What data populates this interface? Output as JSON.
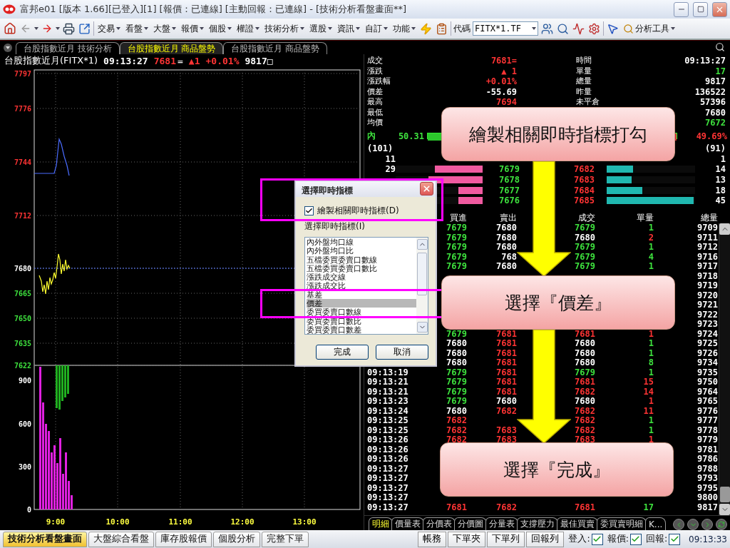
{
  "window": {
    "title": "富邦e01 [版本 1.66][已登入][1] [報價：已連線] [主動回報：已連線] - [技術分析看盤畫面**]"
  },
  "toolbar": {
    "menus": [
      "交易",
      "看盤",
      "大盤",
      "報價",
      "個股",
      "權證",
      "技術分析",
      "選股",
      "資訊",
      "自訂",
      "功能"
    ],
    "code_label": "代碼",
    "code_value": "FITX*1.TF",
    "analysis": "分析工具"
  },
  "tabs": [
    {
      "label": "台股指數近月 技術分析",
      "selected": false
    },
    {
      "label": "台股指數近月 商品盤勢",
      "selected": true
    },
    {
      "label": "台股指數近月 商品盤勢",
      "selected": false
    }
  ],
  "header": {
    "name": "台股指數近月(FITX*1)",
    "time": "09:13:27",
    "price": "7681",
    "flag": "=",
    "change": "▲1",
    "percent": "+0.01%",
    "volume": "9817□"
  },
  "chart": {
    "price_labels": [
      {
        "v": "7797",
        "color": "#ff3434"
      },
      {
        "v": "7776",
        "color": "#ff3434"
      },
      {
        "v": "7744",
        "color": "#ff3434"
      },
      {
        "v": "7712",
        "color": "#ff3434"
      },
      {
        "v": "7680",
        "color": "#ffffff"
      },
      {
        "v": "7665",
        "color": "#3ee23e"
      },
      {
        "v": "7650",
        "color": "#3ee23e"
      },
      {
        "v": "7635",
        "color": "#3ee23e"
      },
      {
        "v": "7622",
        "color": "#3ee23e"
      }
    ],
    "volume_labels": [
      "900",
      "600",
      "300",
      "0"
    ],
    "time_labels": [
      "9:00",
      "10:00",
      "11:00",
      "12:00",
      "13:00"
    ]
  },
  "quote": [
    {
      "left": {
        "label": "成交",
        "value": "7681=",
        "color": "#ff3434"
      },
      "right": {
        "label": "時間",
        "value": "09:13:27",
        "color": "#ffffff"
      }
    },
    {
      "left": {
        "label": "漲跌",
        "value": "▲ 1",
        "color": "#ff3434"
      },
      "right": {
        "label": "單量",
        "value": "17",
        "color": "#3ee23e"
      }
    },
    {
      "left": {
        "label": "漲跌幅",
        "value": "+0.01%",
        "color": "#ff3434"
      },
      "right": {
        "label": "總量",
        "value": "9817",
        "color": "#ffffff"
      }
    },
    {
      "left": {
        "label": "價差",
        "value": "-55.69",
        "color": "#ffffff"
      },
      "right": {
        "label": "昨量",
        "value": "136522",
        "color": "#ffffff"
      }
    },
    {
      "left": {
        "label": "最高",
        "value": "7694",
        "color": "#ff3434"
      },
      "right": {
        "label": "未平倉",
        "value": "57396",
        "color": "#ffffff"
      }
    },
    {
      "left": {
        "label": "最低"
      },
      "right": {
        "value": "7680",
        "color": "#ffffff"
      }
    },
    {
      "left": {
        "label": "均價"
      },
      "right": {
        "value": "7672",
        "color": "#3ee23e"
      }
    }
  ],
  "ratio": {
    "in_label": "內",
    "in_value": "50.31",
    "level": 0.5031,
    "out_value": "49.69%"
  },
  "counts": {
    "left": "(101)",
    "right": "(91)"
  },
  "book": [
    {
      "bid_vol": "11",
      "ask_vol": "1"
    },
    {
      "bid_vol": "29",
      "bid_bar": {
        "level": 0.55
      },
      "bid": "7679",
      "ask": "7682",
      "ask_bar": {
        "level": 0.3
      },
      "ask_vol": "14"
    },
    {
      "bid_bar": {
        "level": 0.62
      },
      "bid": "7678",
      "ask": "7683",
      "ask_bar": {
        "level": 0.28
      },
      "ask_vol": "13"
    },
    {
      "bid_bar": {
        "level": 0.28
      },
      "bid": "7677",
      "ask": "7684",
      "ask_bar": {
        "level": 0.4
      },
      "ask_vol": "18"
    },
    {
      "bid_bar": {
        "level": 0.28
      },
      "bid": "7676",
      "ask": "7685",
      "ask_bar": {
        "level": 0.98
      },
      "ask_vol": "45"
    }
  ],
  "ticks": {
    "columns": [
      "買進",
      "賣出",
      "成交",
      "單量",
      "總量"
    ],
    "rows": [
      {
        "bid": {
          "v": "7679",
          "color": "#3ee23e"
        },
        "ask": {
          "v": "7680",
          "color": "#ffffff"
        },
        "price": {
          "v": "7679",
          "color": "#3ee23e"
        },
        "qty": {
          "v": "1",
          "color": "#3ee23e"
        },
        "total": "9709"
      },
      {
        "bid": {
          "v": "7679",
          "color": "#3ee23e"
        },
        "ask": {
          "v": "7680",
          "color": "#ffffff"
        },
        "price": {
          "v": "7680",
          "color": "#ffffff"
        },
        "qty": {
          "v": "2",
          "color": "#ff3434"
        },
        "total": "9711"
      },
      {
        "bid": {
          "v": "7679",
          "color": "#3ee23e"
        },
        "ask": {
          "v": "7680",
          "color": "#ffffff"
        },
        "price": {
          "v": "7679",
          "color": "#3ee23e"
        },
        "qty": {
          "v": "1",
          "color": "#3ee23e"
        },
        "total": "9712"
      },
      {
        "bid": {
          "v": "7679",
          "color": "#3ee23e"
        },
        "ask": {
          "v": "768",
          "color": "#ffffff"
        },
        "price": {
          "v": "7679",
          "color": "#3ee23e"
        },
        "qty": {
          "v": "4",
          "color": "#3ee23e"
        },
        "total": "9716"
      },
      {
        "bid": {
          "v": "7679",
          "color": "#3ee23e"
        },
        "ask": {
          "v": "7680",
          "color": "#ffffff"
        },
        "price": {
          "v": "7679",
          "color": "#3ee23e"
        },
        "qty": {
          "v": "1",
          "color": "#3ee23e"
        },
        "total": "9717"
      },
      {
        "total": "9718"
      },
      {
        "total": "9719"
      },
      {
        "total": "9720"
      },
      {
        "total": "9721"
      },
      {
        "total": "9722"
      },
      {
        "total": "9723"
      },
      {
        "bid": {
          "v": "7679",
          "color": "#3ee23e"
        },
        "ask": {
          "v": "7681",
          "color": "#ff3434"
        },
        "price": {
          "v": "7681",
          "color": "#ff3434"
        },
        "qty": {
          "v": "1",
          "color": "#ff3434"
        },
        "total": "9724"
      },
      {
        "bid": {
          "v": "7680",
          "color": "#ffffff"
        },
        "ask": {
          "v": "7681",
          "color": "#ff3434"
        },
        "price": {
          "v": "7680",
          "color": "#ffffff"
        },
        "qty": {
          "v": "1",
          "color": "#3ee23e"
        },
        "total": "9725"
      },
      {
        "bid": {
          "v": "7680",
          "color": "#ffffff"
        },
        "ask": {
          "v": "7681",
          "color": "#ff3434"
        },
        "price": {
          "v": "7680",
          "color": "#ffffff"
        },
        "qty": {
          "v": "1",
          "color": "#3ee23e"
        },
        "total": "9726"
      },
      {
        "bid": {
          "v": "7680",
          "color": "#ffffff"
        },
        "ask": {
          "v": "7681",
          "color": "#ff3434"
        },
        "price": {
          "v": "7680",
          "color": "#ffffff"
        },
        "qty": {
          "v": "8",
          "color": "#3ee23e"
        },
        "total": "9734"
      },
      {
        "time": "09:13:19",
        "bid": {
          "v": "7679",
          "color": "#3ee23e"
        },
        "ask": {
          "v": "7681",
          "color": "#ff3434"
        },
        "price": {
          "v": "7679",
          "color": "#3ee23e"
        },
        "qty": {
          "v": "1",
          "color": "#3ee23e"
        },
        "total": "9735"
      },
      {
        "time": "09:13:21",
        "bid": {
          "v": "7679",
          "color": "#3ee23e"
        },
        "ask": {
          "v": "7681",
          "color": "#ff3434"
        },
        "price": {
          "v": "7681",
          "color": "#ff3434"
        },
        "qty": {
          "v": "15",
          "color": "#ff3434"
        },
        "total": "9750"
      },
      {
        "time": "09:13:21",
        "bid": {
          "v": "7679",
          "color": "#3ee23e"
        },
        "ask": {
          "v": "7681",
          "color": "#ff3434"
        },
        "price": {
          "v": "7682",
          "color": "#ff3434"
        },
        "qty": {
          "v": "14",
          "color": "#ff3434"
        },
        "total": "9764"
      },
      {
        "time": "09:13:23",
        "bid": {
          "v": "7679",
          "color": "#3ee23e"
        },
        "ask": {
          "v": "7680",
          "color": "#ffffff"
        },
        "price": {
          "v": "7680",
          "color": "#ffffff"
        },
        "qty": {
          "v": "1",
          "color": "#ff3434"
        },
        "total": "9765"
      },
      {
        "time": "09:13:24",
        "bid": {
          "v": "7680",
          "color": "#ffffff"
        },
        "ask": {
          "v": "7682",
          "color": "#ff3434"
        },
        "price": {
          "v": "7682",
          "color": "#ff3434"
        },
        "qty": {
          "v": "11",
          "color": "#ff3434"
        },
        "total": "9776"
      },
      {
        "time": "09:13:25",
        "bid": {
          "v": "7682",
          "color": "#ff3434"
        },
        "price": {
          "v": "7682",
          "color": "#ff3434"
        },
        "qty": {
          "v": "1",
          "color": "#3ee23e"
        },
        "total": "9777"
      },
      {
        "time": "09:13:25",
        "bid": {
          "v": "7682",
          "color": "#ff3434"
        },
        "ask": {
          "v": "7683",
          "color": "#ff3434"
        },
        "price": {
          "v": "7682",
          "color": "#ff3434"
        },
        "qty": {
          "v": "1",
          "color": "#3ee23e"
        },
        "total": "9778"
      },
      {
        "time": "09:13:26",
        "bid": {
          "v": "7682",
          "color": "#ff3434"
        },
        "ask": {
          "v": "7683",
          "color": "#ff3434"
        },
        "price": {
          "v": "7683",
          "color": "#ff3434"
        },
        "qty": {
          "v": "1",
          "color": "#ff3434"
        },
        "total": "9779"
      },
      {
        "time": "09:13:26",
        "total": "9781"
      },
      {
        "time": "09:13:26",
        "total": "9786"
      },
      {
        "time": "09:13:27",
        "total": "9788"
      },
      {
        "time": "09:13:27",
        "total": "9793"
      },
      {
        "time": "09:13:27",
        "total": "9795"
      },
      {
        "time": "09:13:27",
        "total": "9800"
      },
      {
        "time": "09:13:27",
        "bid": {
          "v": "7681",
          "color": "#ff3434"
        },
        "ask": {
          "v": "7682",
          "color": "#ff3434"
        },
        "price": {
          "v": "7681",
          "color": "#ff3434"
        },
        "qty": {
          "v": "17",
          "color": "#3ee23e"
        },
        "total": "9817"
      }
    ]
  },
  "detail_tabs": [
    {
      "label": "明細",
      "selected": true
    },
    {
      "label": "價量表",
      "selected": false
    },
    {
      "label": "分價表",
      "selected": false
    },
    {
      "label": "分價圖",
      "selected": false
    },
    {
      "label": "分量表",
      "selected": false
    },
    {
      "label": "支撐壓力",
      "selected": false
    },
    {
      "label": "最佳買賣",
      "selected": false
    },
    {
      "label": "委買賣明細",
      "selected": false
    },
    {
      "label": "K...",
      "selected": false
    }
  ],
  "taskbar": {
    "tabs": [
      {
        "label": "技術分析看盤畫面",
        "selected": true
      },
      {
        "label": "大盤綜合看盤",
        "selected": false
      },
      {
        "label": "庫存股報價",
        "selected": false
      },
      {
        "label": "個股分析",
        "selected": false
      },
      {
        "label": "完整下單",
        "selected": false
      }
    ],
    "buttons": [
      "帳務",
      "下單夾",
      "下單列",
      "回報列"
    ],
    "indicators": [
      {
        "label": "登入:",
        "checked": true
      },
      {
        "label": "報價:",
        "checked": true
      },
      {
        "label": "回報:",
        "checked": true
      }
    ],
    "clock": "09:13:33"
  },
  "dialog": {
    "title": "選擇即時指標",
    "draw": {
      "label": "繪製相關即時指標(D)",
      "checked": true
    },
    "list_label": "選擇即時指標(I)",
    "items": [
      {
        "label": "內外盤均口線",
        "selected": false
      },
      {
        "label": "內外盤均口比",
        "selected": false
      },
      {
        "label": "五檔委買委賣口數線",
        "selected": false
      },
      {
        "label": "五檔委買委賣口數比",
        "selected": false
      },
      {
        "label": "漲跌成交線",
        "selected": false
      },
      {
        "label": "漲跌成交比",
        "selected": false
      },
      {
        "label": "基差",
        "selected": false
      },
      {
        "label": "價差",
        "selected": true
      },
      {
        "label": "委買委賣口數線",
        "selected": false
      },
      {
        "label": "委買委賣口數比",
        "selected": false
      },
      {
        "label": "委買委賣口數差",
        "selected": false
      }
    ],
    "buttons": [
      "完成",
      "取消"
    ]
  },
  "callouts": [
    "繪製相關即時指標打勾",
    "選擇『價差』",
    "選擇『完成』"
  ]
}
